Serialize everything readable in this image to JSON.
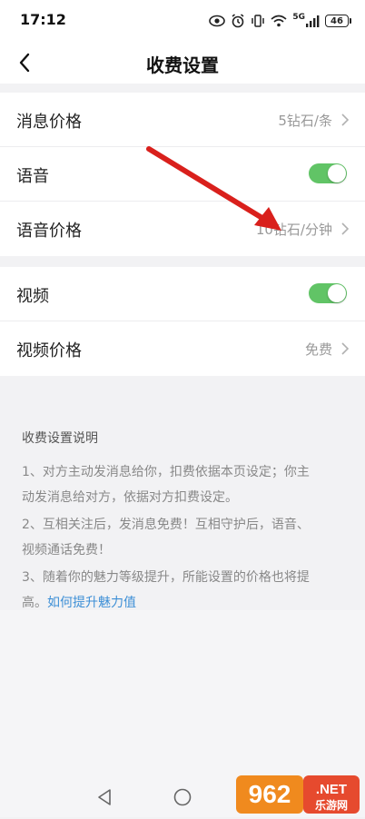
{
  "status_bar": {
    "time": "17:12",
    "network": "5G",
    "battery": "46",
    "icons": [
      "eye-icon",
      "alarm-icon",
      "vibrate-icon",
      "wifi-icon",
      "signal-icon",
      "battery-icon"
    ]
  },
  "header": {
    "title": "收费设置",
    "back_icon": "back-chevron-icon"
  },
  "sections": [
    {
      "rows": [
        {
          "label": "消息价格",
          "value": "5钻石/条",
          "type": "link"
        },
        {
          "label": "语音",
          "type": "toggle",
          "enabled": true
        },
        {
          "label": "语音价格",
          "value": "10钻石/分钟",
          "type": "link"
        }
      ]
    },
    {
      "rows": [
        {
          "label": "视频",
          "type": "toggle",
          "enabled": true
        },
        {
          "label": "视频价格",
          "value": "免费",
          "type": "link"
        }
      ]
    }
  ],
  "notes": {
    "title": "收费设置说明",
    "items": [
      {
        "line1": "1、对方主动发消息给你，扣费依据本页设定；你主",
        "line2": "动发消息给对方，依据对方扣费设定。"
      },
      {
        "line1": "2、互相关注后，发消息免费！互相守护后，语音、",
        "line2": "视频通话免费！"
      },
      {
        "line1": "3、随着你的魅力等级提升，所能设置的价格也将提",
        "line2_prefix": "高。",
        "link": "如何提升魅力值"
      }
    ]
  },
  "watermark": {
    "number": "962",
    "suffix": ".NET",
    "subtitle": "乐游网"
  },
  "colors": {
    "toggle_on": "#61c466",
    "link": "#3d8fd6",
    "arrow": "#d9201c",
    "background": "#f2f2f4"
  }
}
